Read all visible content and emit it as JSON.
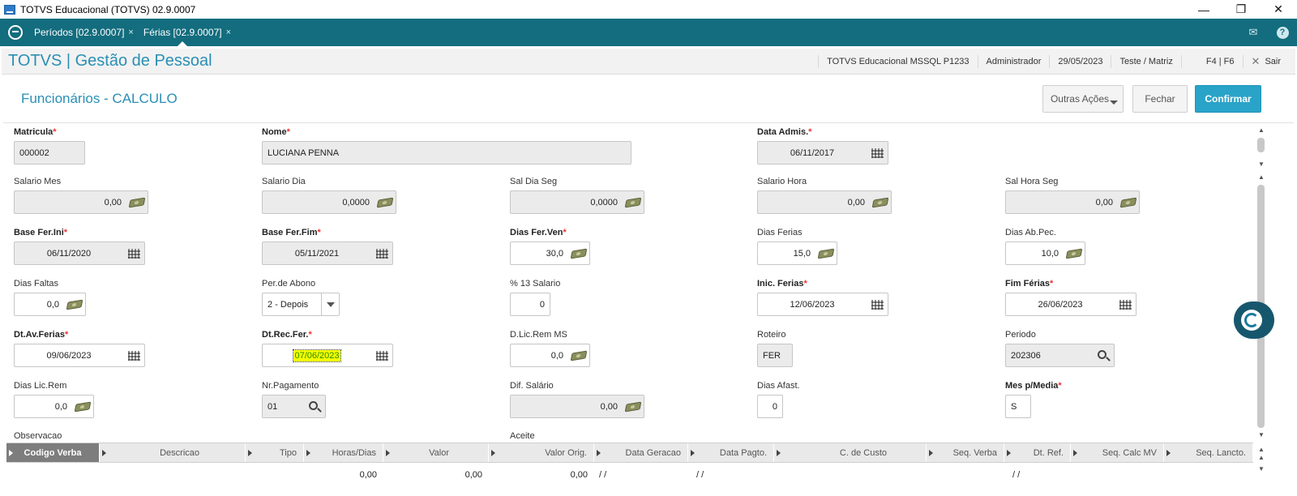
{
  "window": {
    "title": "TOTVS Educacional (TOTVS) 02.9.0007",
    "controls": [
      "—",
      "❐",
      "✕"
    ]
  },
  "tabs": [
    {
      "label": "Períodos [02.9.0007]",
      "close": "×"
    },
    {
      "label": "Férias [02.9.0007]",
      "close": "×"
    }
  ],
  "header": {
    "app_title": "TOTVS | Gestão de Pessoal",
    "environment": "TOTVS Educacional MSSQL P1233",
    "user": "Administrador",
    "date": "29/05/2023",
    "branch": "Teste / Matriz",
    "keys": "F4 | F6",
    "exit_icon": "✕",
    "exit_label": "Sair"
  },
  "page": {
    "title": "Funcionários - CALCULO",
    "btn_other": "Outras Ações",
    "btn_close": "Fechar",
    "btn_confirm": "Confirmar"
  },
  "fields": {
    "matricula": {
      "label": "Matricula",
      "value": "000002"
    },
    "nome": {
      "label": "Nome",
      "value": "LUCIANA PENNA"
    },
    "data_admis": {
      "label": "Data Admis.",
      "value": "06/11/2017"
    },
    "salario_mes": {
      "label": "Salario Mes",
      "value": "0,00"
    },
    "salario_dia": {
      "label": "Salario Dia",
      "value": "0,0000"
    },
    "sal_dia_seg": {
      "label": "Sal Dia Seg",
      "value": "0,0000"
    },
    "salario_hora": {
      "label": "Salario Hora",
      "value": "0,00"
    },
    "sal_hora_seg": {
      "label": "Sal Hora Seg",
      "value": "0,00"
    },
    "base_fer_ini": {
      "label": "Base Fer.Ini",
      "value": "06/11/2020"
    },
    "base_fer_fim": {
      "label": "Base Fer.Fim",
      "value": "05/11/2021"
    },
    "dias_fer_ven": {
      "label": "Dias Fer.Ven",
      "value": "30,0"
    },
    "dias_ferias": {
      "label": "Dias Ferias",
      "value": "15,0"
    },
    "dias_ab_pec": {
      "label": "Dias Ab.Pec.",
      "value": "10,0"
    },
    "dias_faltas": {
      "label": "Dias Faltas",
      "value": "0,0"
    },
    "per_abono": {
      "label": "Per.de Abono",
      "value": "2 - Depois"
    },
    "pct_13_salario": {
      "label": "% 13 Salario",
      "value": "0"
    },
    "inic_ferias": {
      "label": "Inic. Ferias",
      "value": "12/06/2023"
    },
    "fim_ferias": {
      "label": "Fim Férias",
      "value": "26/06/2023"
    },
    "dt_av_ferias": {
      "label": "Dt.Av.Ferias",
      "value": "09/06/2023"
    },
    "dt_rec_fer": {
      "label": "Dt.Rec.Fer.",
      "value": "07/06/2023"
    },
    "d_lic_rem_ms": {
      "label": "D.Lic.Rem MS",
      "value": "0,0"
    },
    "roteiro": {
      "label": "Roteiro",
      "value": "FER"
    },
    "periodo": {
      "label": "Periodo",
      "value": "202306"
    },
    "dias_lic_rem": {
      "label": "Dias Lic.Rem",
      "value": "0,0"
    },
    "nr_pagamento": {
      "label": "Nr.Pagamento",
      "value": "01"
    },
    "dif_salario": {
      "label": "Dif. Salário",
      "value": "0,00"
    },
    "dias_afast": {
      "label": "Dias Afast.",
      "value": "0"
    },
    "mes_p_media": {
      "label": "Mes p/Media",
      "value": "S"
    },
    "observacao": {
      "label": "Observacao"
    },
    "aceite": {
      "label": "Aceite"
    }
  },
  "required_mark": "*",
  "grid": {
    "columns": [
      "Codigo Verba",
      "Descricao",
      "Tipo",
      "Horas/Dias",
      "Valor",
      "Valor Orig.",
      "Data Geracao",
      "Data Pagto.",
      "C. de Custo",
      "Seq. Verba",
      "Dt. Ref.",
      "Seq. Calc MV",
      "Seq. Lancto."
    ],
    "row": {
      "horas_dias": "0,00",
      "valor": "0,00",
      "valor_orig": "0,00",
      "data_geracao": "/ /",
      "data_pagto": "/ /",
      "dt_ref": "/ /"
    }
  },
  "icons": [
    "app-icon",
    "totvs-logo-icon",
    "mail-icon",
    "help-icon",
    "calendar-icon",
    "money-icon",
    "search-icon",
    "dropdown-icon",
    "chat-icon"
  ]
}
